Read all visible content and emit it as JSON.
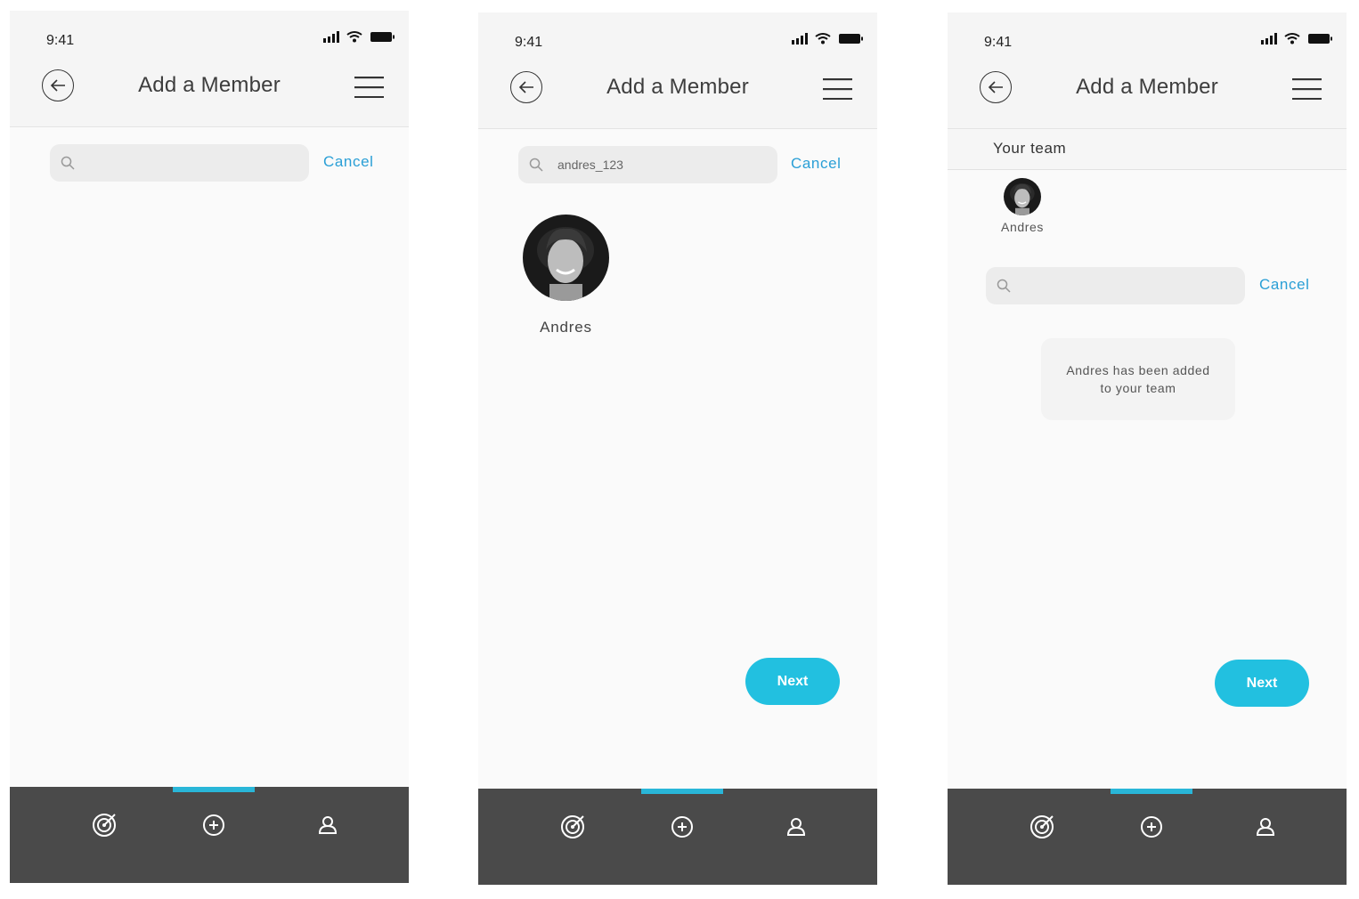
{
  "screens": [
    {
      "status_time": "9:41",
      "title": "Add a Member",
      "search": {
        "value": "",
        "cancel_label": "Cancel"
      }
    },
    {
      "status_time": "9:41",
      "title": "Add a Member",
      "search": {
        "value": "andres_123",
        "cancel_label": "Cancel"
      },
      "result": {
        "name": "Andres"
      },
      "next_label": "Next"
    },
    {
      "status_time": "9:41",
      "title": "Add a Member",
      "team_label": "Your team",
      "team_members": [
        {
          "name": "Andres"
        }
      ],
      "search": {
        "value": "",
        "cancel_label": "Cancel"
      },
      "toast_line1": "Andres has been added",
      "toast_line2": "to your team",
      "next_label": "Next"
    }
  ],
  "tabbar": {
    "active_index": 1,
    "tabs": [
      "target-icon",
      "add-circle-icon",
      "profile-icon"
    ]
  },
  "colors": {
    "accent": "#22c0e0",
    "link": "#2a9fd6",
    "tabbar_bg": "#4a4a4a",
    "indicator": "#29b6d8"
  }
}
